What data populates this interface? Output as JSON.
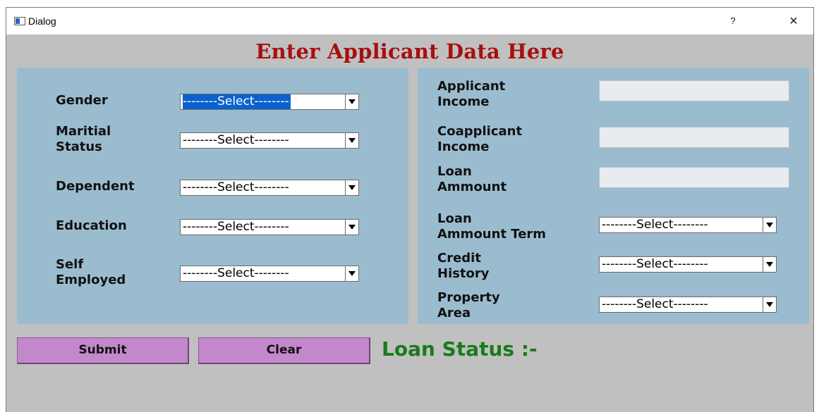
{
  "window": {
    "title": "Dialog",
    "help_label": "?",
    "close_label": "×"
  },
  "heading": "Enter Applicant Data Here",
  "left_fields": [
    {
      "label": "Gender",
      "value": "--------Select--------"
    },
    {
      "label": "Maritial\nStatus",
      "value": "--------Select--------"
    },
    {
      "label": "Dependent",
      "value": "--------Select--------"
    },
    {
      "label": "Education",
      "value": "--------Select--------"
    },
    {
      "label": "Self\nEmployed",
      "value": "--------Select--------"
    }
  ],
  "right_fields": [
    {
      "label": "Applicant\nIncome",
      "value": ""
    },
    {
      "label": "Coapplicant\nIncome",
      "value": ""
    },
    {
      "label": "Loan\nAmmount",
      "value": ""
    },
    {
      "label": "Loan\nAmmount Term",
      "value": "--------Select--------"
    },
    {
      "label": "Credit\nHistory",
      "value": "--------Select--------"
    },
    {
      "label": "Property\nArea",
      "value": "--------Select--------"
    }
  ],
  "buttons": {
    "submit": "Submit",
    "clear": "Clear"
  },
  "status_label": "Loan Status :-",
  "colors": {
    "heading": "#a80f0f",
    "panel": "#9bbcce",
    "button": "#c288cb",
    "status": "#1a7a1a",
    "selection": "#0a62cf"
  },
  "icons": {
    "app": "dialog-window-icon",
    "dropdown": "chevron-down-icon"
  }
}
